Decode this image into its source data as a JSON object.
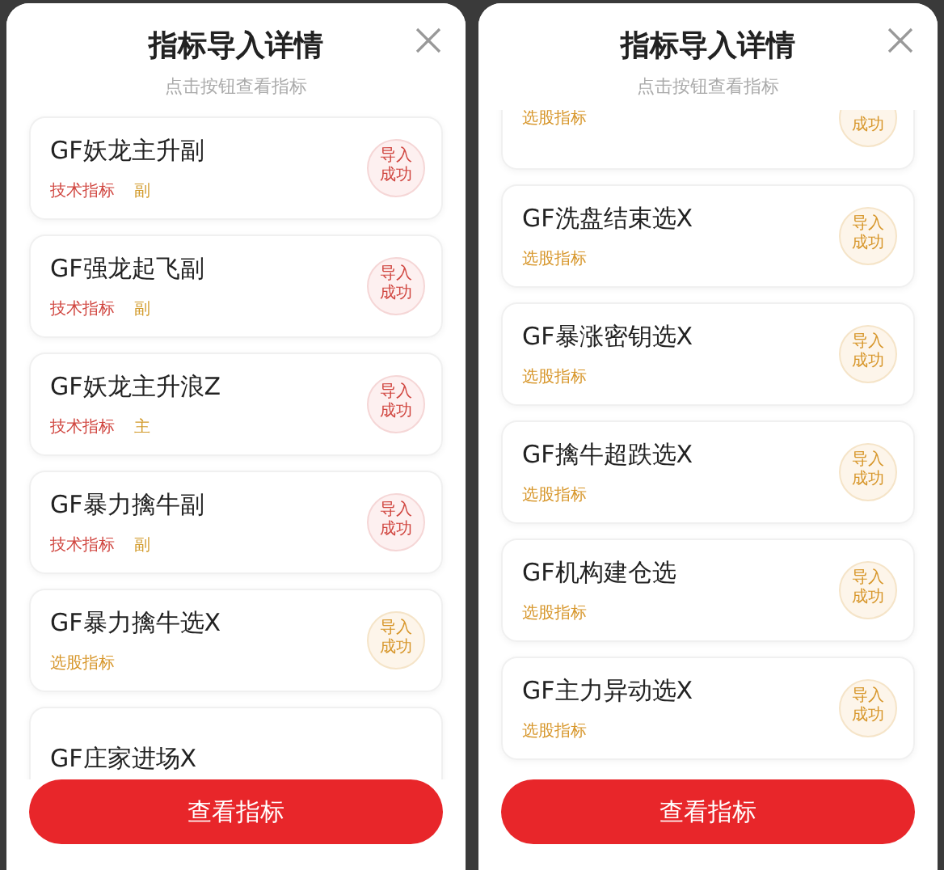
{
  "panels": [
    {
      "title": "指标导入详情",
      "subtitle": "点击按钮查看指标",
      "button": "查看指标",
      "items": [
        {
          "name": "GF妖龙主升副",
          "kind": "tech",
          "tag": "技术指标",
          "sub": "副",
          "badge": [
            "导入",
            "成功"
          ]
        },
        {
          "name": "GF强龙起飞副",
          "kind": "tech",
          "tag": "技术指标",
          "sub": "副",
          "badge": [
            "导入",
            "成功"
          ]
        },
        {
          "name": "GF妖龙主升浪Z",
          "kind": "tech",
          "tag": "技术指标",
          "sub": "主",
          "badge": [
            "导入",
            "成功"
          ]
        },
        {
          "name": "GF暴力擒牛副",
          "kind": "tech",
          "tag": "技术指标",
          "sub": "副",
          "badge": [
            "导入",
            "成功"
          ]
        },
        {
          "name": "GF暴力擒牛选X",
          "kind": "select",
          "tag": "选股指标",
          "badge": [
            "导入",
            "成功"
          ]
        },
        {
          "name": "GF庄家进场X",
          "kind": "select"
        }
      ]
    },
    {
      "title": "指标导入详情",
      "subtitle": "点击按钮查看指标",
      "button": "查看指标",
      "items": [
        {
          "kind": "select",
          "tag": "选股指标",
          "badge": [
            "成功"
          ]
        },
        {
          "name": "GF洗盘结束选X",
          "kind": "select",
          "tag": "选股指标",
          "badge": [
            "导入",
            "成功"
          ]
        },
        {
          "name": "GF暴涨密钥选X",
          "kind": "select",
          "tag": "选股指标",
          "badge": [
            "导入",
            "成功"
          ]
        },
        {
          "name": "GF擒牛超跌选X",
          "kind": "select",
          "tag": "选股指标",
          "badge": [
            "导入",
            "成功"
          ]
        },
        {
          "name": "GF机构建仓选",
          "kind": "select",
          "tag": "选股指标",
          "badge": [
            "导入",
            "成功"
          ]
        },
        {
          "name": "GF主力异动选X",
          "kind": "select",
          "tag": "选股指标",
          "badge": [
            "导入",
            "成功"
          ]
        }
      ]
    }
  ]
}
